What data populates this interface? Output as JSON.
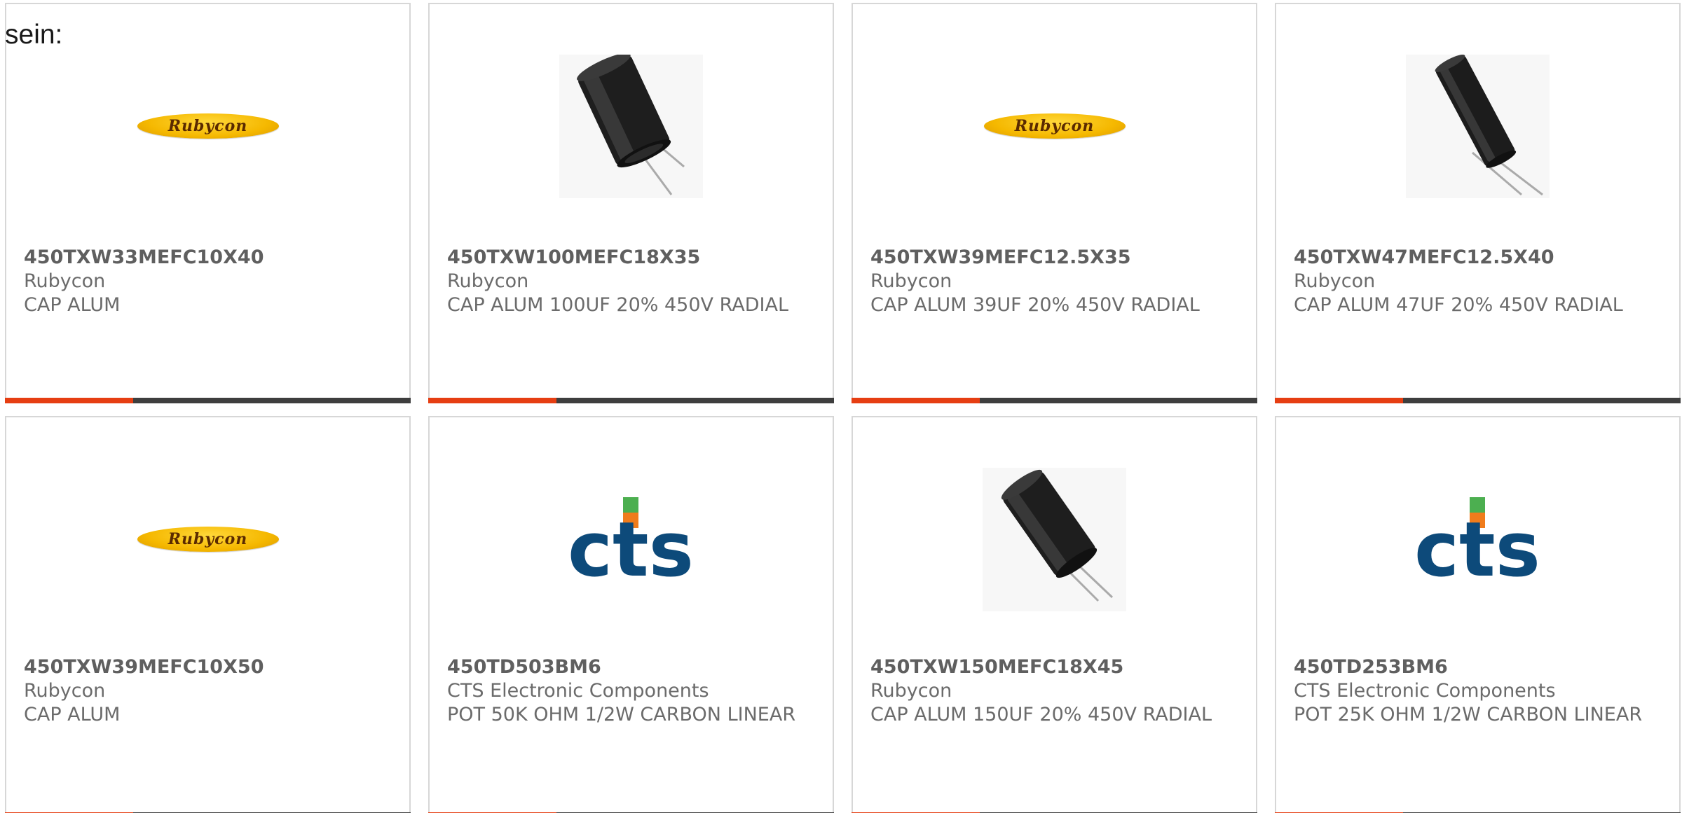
{
  "intro_text": "sein:",
  "products": [
    {
      "part_number": "450TXW33MEFC10X40",
      "manufacturer": "Rubycon",
      "description": "CAP ALUM",
      "image": "rubycon-logo"
    },
    {
      "part_number": "450TXW100MEFC18X35",
      "manufacturer": "Rubycon",
      "description": "CAP ALUM 100UF 20% 450V RADIAL",
      "image": "capacitor-photo"
    },
    {
      "part_number": "450TXW39MEFC12.5X35",
      "manufacturer": "Rubycon",
      "description": "CAP ALUM 39UF 20% 450V RADIAL",
      "image": "rubycon-logo"
    },
    {
      "part_number": "450TXW47MEFC12.5X40",
      "manufacturer": "Rubycon",
      "description": "CAP ALUM 47UF 20% 450V RADIAL",
      "image": "capacitor-photo"
    },
    {
      "part_number": "450TXW39MEFC10X50",
      "manufacturer": "Rubycon",
      "description": "CAP ALUM",
      "image": "rubycon-logo"
    },
    {
      "part_number": "450TD503BM6",
      "manufacturer": "CTS Electronic Components",
      "description": "POT 50K OHM 1/2W CARBON LINEAR",
      "image": "cts-logo"
    },
    {
      "part_number": "450TXW150MEFC18X45",
      "manufacturer": "Rubycon",
      "description": "CAP ALUM 150UF 20% 450V RADIAL",
      "image": "capacitor-photo"
    },
    {
      "part_number": "450TD253BM6",
      "manufacturer": "CTS Electronic Components",
      "description": "POT 25K OHM 1/2W CARBON LINEAR",
      "image": "cts-logo"
    }
  ],
  "logos": {
    "rubycon_text": "Rubycon",
    "cts_text": "cts"
  },
  "colors": {
    "accent": "#e63e12",
    "bar": "#3e3e3e",
    "border": "#d7d7d7",
    "cts_blue": "#0d4a7a",
    "cts_green": "#4caf50",
    "cts_orange": "#f07c1c"
  }
}
